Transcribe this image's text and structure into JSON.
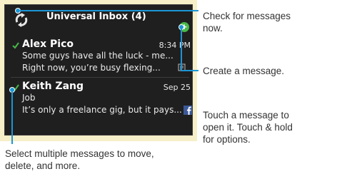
{
  "widget": {
    "title": "Universal Inbox (4)",
    "messages": [
      {
        "sender": "Alex Pico",
        "time": "8:34 PM",
        "line1": "Some guys have all the luck - me...",
        "line2": "Right now, you’re busy flexing..."
      },
      {
        "sender": "Keith Zang",
        "time": "Sep 25",
        "line1": "Job",
        "line2": "It’s only a freelance gig, but it pays..."
      }
    ]
  },
  "callouts": {
    "check_line1": "Check for messages",
    "check_line2": "now.",
    "create": "Create a message.",
    "touch_line1": "Touch a message to",
    "touch_line2": "open it. Touch & hold",
    "touch_line3": "for options.",
    "select_line1": "Select multiple messages to move,",
    "select_line2": "delete, and more."
  },
  "colors": {
    "callout_blue": "#1b96d6",
    "check_green": "#48b84a",
    "widget_bg": "#1f1f1f",
    "frame_bg": "#f6efc8"
  }
}
